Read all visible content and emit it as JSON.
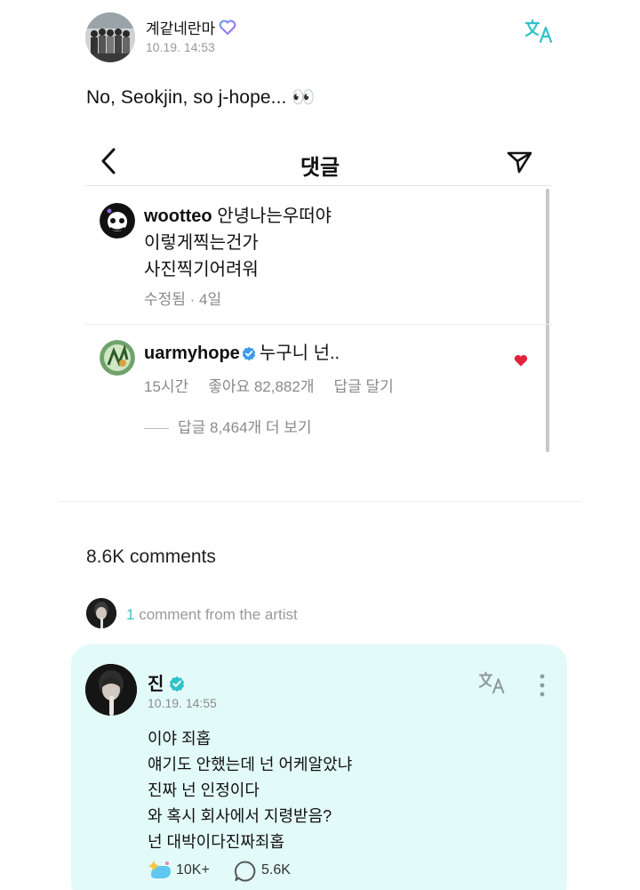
{
  "post": {
    "author": "계같네란마",
    "time": "10.19. 14:53",
    "text": "No, Seokjin, so j-hope... 👀",
    "icons": {
      "translate": "translate-icon",
      "heart": "purple-heart-icon"
    }
  },
  "screenshot": {
    "title": "댓글",
    "comments": [
      {
        "username": "wootteo",
        "lines": [
          "안녕나는우떠야",
          "이렇게찍는건가",
          "사진찍기어려워"
        ],
        "meta": "수정됨 · 4일"
      },
      {
        "username": "uarmyhope",
        "text": "누구니 넌..",
        "time": "15시간",
        "likes": "좋아요 82,882개",
        "reply": "답글 달기",
        "view_replies": "답글 8,464개 더 보기"
      }
    ]
  },
  "comments_section": {
    "count_label": "8.6K comments",
    "artist_count": "1",
    "artist_label": " comment from the artist"
  },
  "artist_comment": {
    "name": "진",
    "time": "10.19. 14:55",
    "lines": [
      "이야 죄홉",
      "얘기도 안했는데 넌 어케알았냐",
      "진짜 넌 인정이다",
      "와 혹시 회사에서 지령받음?",
      "넌 대박이다진짜죄홉"
    ],
    "likes": "10K+",
    "comments": "5.6K"
  },
  "colors": {
    "accent": "#37c2ca",
    "card_bg": "#e3fbf8",
    "like_red": "#e0243b",
    "verified": "#3d9ae8"
  }
}
